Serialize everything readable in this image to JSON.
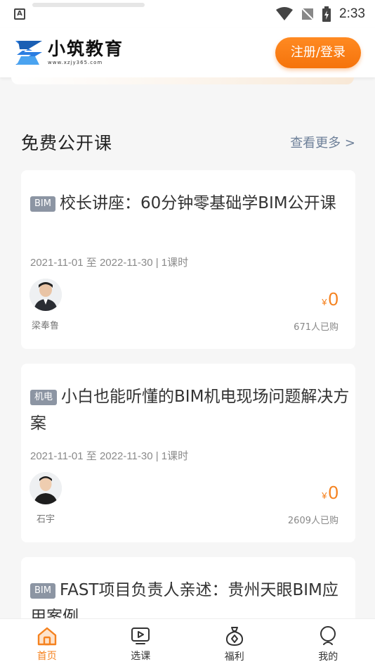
{
  "status_bar": {
    "time": "2:33",
    "notification_icon": "A"
  },
  "header": {
    "logo_title": "小筑教育",
    "logo_url": "www.xzjy365.com",
    "login_label": "注册/登录"
  },
  "section": {
    "title": "免费公开课",
    "more_label": "查看更多 >"
  },
  "courses": [
    {
      "tag": "BIM",
      "title": "校长讲座：60分钟零基础学BIM公开课",
      "meta": "2021-11-01 至 2022-11-30 | 1课时",
      "teacher": "梁奉鲁",
      "currency": "¥",
      "price": "0",
      "sold": "671人已购"
    },
    {
      "tag": "机电",
      "title": "小白也能听懂的BIM机电现场问题解决方案",
      "meta": "2021-11-01 至 2022-11-30 | 1课时",
      "teacher": "石宇",
      "currency": "¥",
      "price": "0",
      "sold": "2609人已购"
    },
    {
      "tag": "BIM",
      "title": "FAST项目负责人亲述：贵州天眼BIM应用案例"
    }
  ],
  "tabs": [
    {
      "label": "首页",
      "icon": "home-icon",
      "active": true
    },
    {
      "label": "选课",
      "icon": "play-icon",
      "active": false
    },
    {
      "label": "福利",
      "icon": "gift-icon",
      "active": false
    },
    {
      "label": "我的",
      "icon": "user-icon",
      "active": false
    }
  ],
  "colors": {
    "accent": "#f5821f",
    "tag_bg": "#8c95a3",
    "more_link": "#6e8099"
  }
}
